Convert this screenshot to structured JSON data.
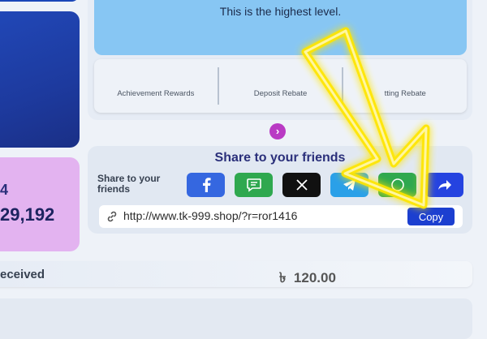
{
  "level": {
    "text": "This is the highest level."
  },
  "tabs": [
    {
      "label": "Achievement Rewards"
    },
    {
      "label": "Deposit Rebate"
    },
    {
      "label": "tting Rebate"
    }
  ],
  "left_cards": {
    "partial_number": "4",
    "big_number": "29,192"
  },
  "share": {
    "title": "Share to your friends",
    "label": "Share to your friends",
    "buttons": [
      {
        "name": "facebook",
        "color": "#3567e0"
      },
      {
        "name": "message",
        "color": "#2fa84f"
      },
      {
        "name": "x",
        "color": "#111111"
      },
      {
        "name": "telegram",
        "color": "#2aa0e8"
      },
      {
        "name": "whatsapp",
        "color": "#2fa84f"
      },
      {
        "name": "share",
        "color": "#2543e0"
      }
    ],
    "url": "http://www.tk-999.shop/?r=ror1416",
    "copy_label": "Copy"
  },
  "received": {
    "label": "eceived",
    "amount": "120.00",
    "currency_symbol": "৳"
  },
  "overlay": {
    "arrow_color": "#ffe600",
    "description": "yellow-arrow-pointing-to-copy-button"
  }
}
